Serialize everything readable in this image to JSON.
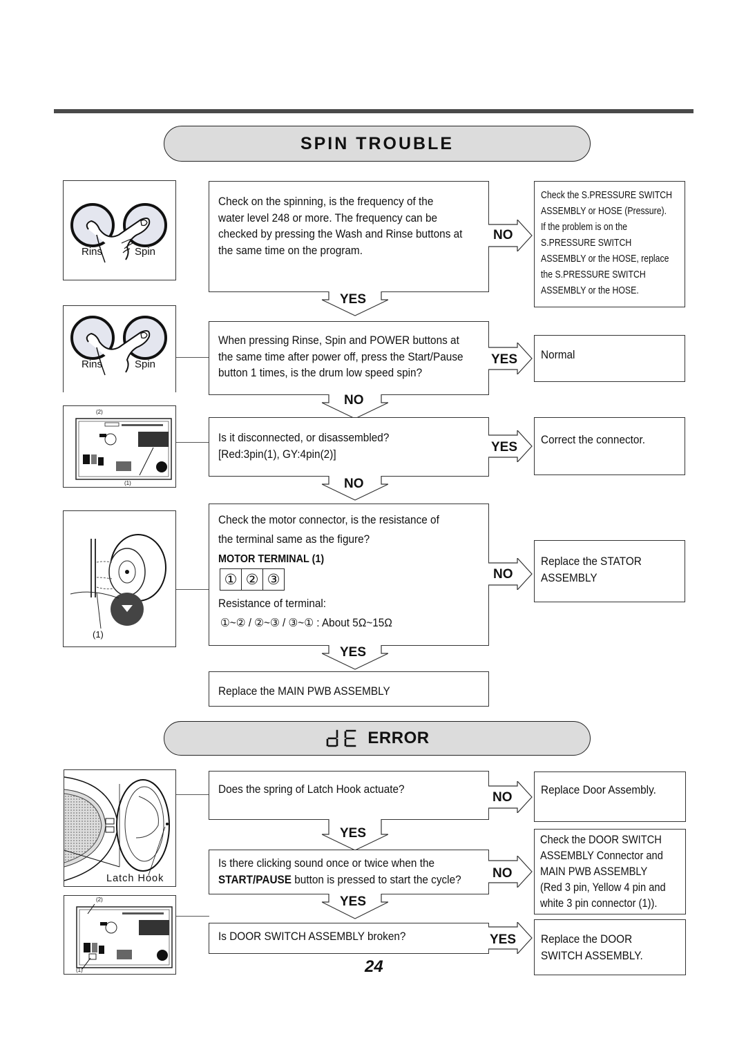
{
  "page_number": "24",
  "spin_trouble": {
    "title": "SPIN TROUBLE",
    "images": [
      {
        "name": "rinse-spin-buttons",
        "labels": [
          "Rins",
          "Spin"
        ]
      },
      {
        "name": "rinse-spin-buttons",
        "labels": [
          "Rins",
          "Spin"
        ]
      },
      {
        "name": "main-pwb",
        "labels": [
          "(2)",
          "(1)"
        ]
      },
      {
        "name": "motor-stator",
        "labels": [
          "(1)"
        ]
      }
    ],
    "steps": [
      {
        "question": [
          "Check on the spinning, is the frequency of the",
          "water level 248 or more. The frequency can be",
          "checked by pressing the Wash and Rinse buttons at",
          "the same time on the program."
        ],
        "side_label": "NO",
        "side_result": [
          "Check the S.PRESSURE SWITCH",
          "ASSEMBLY or HOSE (Pressure).",
          "If the problem is on the",
          "S.PRESSURE SWITCH",
          "ASSEMBLY or the HOSE, replace",
          "the S.PRESSURE SWITCH",
          "ASSEMBLY or the HOSE."
        ],
        "down_label": "YES"
      },
      {
        "question": [
          "When pressing Rinse, Spin and POWER buttons at",
          "the same time after power off, press the  Start/Pause",
          "button 1 times, is the drum low speed spin?"
        ],
        "side_label": "YES",
        "side_result": [
          "Normal"
        ],
        "down_label": "NO"
      },
      {
        "question": [
          "Is it disconnected, or disassembled?",
          "[Red:3pin(1), GY:4pin(2)]"
        ],
        "side_label": "YES",
        "side_result": [
          "Correct the connector."
        ],
        "down_label": "NO"
      },
      {
        "question": [
          "Check the motor connector, is the resistance of",
          "the terminal same as the figure?"
        ],
        "terminal_title": "MOTOR TERMINAL (1)",
        "terminals": [
          "①",
          "②",
          "③"
        ],
        "resistance_label": "Resistance of terminal:",
        "resistance_value": "①~② / ②~③ / ③~① : About 5Ω~15Ω",
        "side_label": "NO",
        "side_result": [
          "Replace the STATOR",
          "ASSEMBLY"
        ],
        "down_label": "YES"
      },
      {
        "question": [
          "Replace the MAIN PWB ASSEMBLY"
        ]
      }
    ]
  },
  "de_error": {
    "code": "dE",
    "title": "ERROR",
    "images": [
      {
        "name": "door-latch",
        "labels": [
          "Latch Hook"
        ]
      },
      {
        "name": "main-pwb",
        "labels": [
          "(2)",
          "(1)"
        ]
      }
    ],
    "steps": [
      {
        "question": [
          "Does the spring of Latch Hook actuate?"
        ],
        "side_label": "NO",
        "side_result": [
          "Replace Door Assembly."
        ],
        "down_label": "YES"
      },
      {
        "question_line1": "Is there clicking sound once or twice when the",
        "question_bold": "START/PAUSE",
        "question_line2_rest": " button is pressed to start the cycle?",
        "side_label": "NO",
        "side_result": [
          "Check the DOOR SWITCH",
          "ASSEMBLY Connector and",
          "MAIN PWB ASSEMBLY",
          "(Red 3 pin, Yellow 4 pin and",
          "white 3 pin connector (1))."
        ],
        "down_label": "YES"
      },
      {
        "question": [
          "Is DOOR SWITCH ASSEMBLY broken?"
        ],
        "side_label": "YES",
        "side_result": [
          "Replace the DOOR",
          "SWITCH ASSEMBLY."
        ]
      }
    ]
  }
}
